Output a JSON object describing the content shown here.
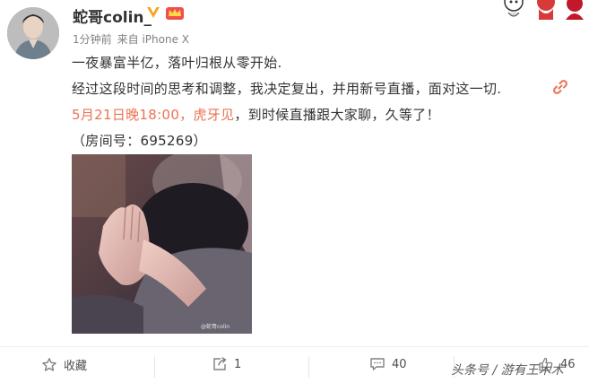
{
  "post": {
    "username": "蛇哥colin_",
    "time": "1分钟前",
    "via": "来自 iPhone X",
    "lines": {
      "line1": "一夜暴富半亿，落叶归根从零开始.",
      "line2": "经过这段时间的思考和调整，我决定复出，并用新号直播，面对这一切.",
      "line3_link1": "5月21日晚18:00，",
      "line3_link2": "虎牙见",
      "line3_rest": "，到时候直播跟大家聊，久等了！",
      "line4": "（房间号：695269）"
    },
    "image_watermark": "@蛇哥colin"
  },
  "actions": {
    "favorite_label": "收藏",
    "repost_count": "1",
    "comment_count": "40",
    "like_count": "46"
  },
  "source_overlay": "头条号 / 游有王木木",
  "colors": {
    "link": "#eb7350",
    "vip_badge": "#f5a623",
    "text": "#333333",
    "muted": "#808080"
  },
  "icons": {
    "favorite": "star-icon",
    "repost": "repost-icon",
    "comment": "comment-icon",
    "like": "thumbs-up-icon",
    "attachment": "link-icon",
    "verified": "verified-v-icon"
  }
}
